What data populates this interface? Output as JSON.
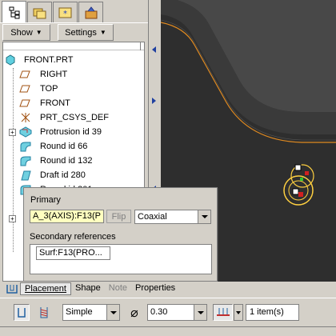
{
  "tabs": [
    {
      "icon": "model-tree-icon",
      "active": true
    },
    {
      "icon": "folder-browser-icon",
      "active": false
    },
    {
      "icon": "favorites-icon",
      "active": false
    },
    {
      "icon": "connections-icon",
      "active": false
    }
  ],
  "toolbar": {
    "show_label": "Show",
    "settings_label": "Settings"
  },
  "tree": {
    "root": "FRONT.PRT",
    "items": [
      {
        "label": "RIGHT",
        "icon": "datum-plane-icon"
      },
      {
        "label": "TOP",
        "icon": "datum-plane-icon"
      },
      {
        "label": "FRONT",
        "icon": "datum-plane-icon"
      },
      {
        "label": "PRT_CSYS_DEF",
        "icon": "csys-icon"
      },
      {
        "label": "Protrusion id 39",
        "icon": "protrusion-icon"
      },
      {
        "label": "Round id 66",
        "icon": "round-icon"
      },
      {
        "label": "Round id 132",
        "icon": "round-icon"
      },
      {
        "label": "Draft id 280",
        "icon": "draft-icon"
      },
      {
        "label": "Round id 301",
        "icon": "round-icon"
      }
    ]
  },
  "placement": {
    "primary_label": "Primary",
    "primary_value": "A_3(AXIS):F13(P",
    "flip_label": "Flip",
    "coaxial_value": "Coaxial",
    "secondary_label": "Secondary references",
    "secondary_item": "Surf:F13(PRO..."
  },
  "dashboard": {
    "tabs": [
      "Placement",
      "Shape",
      "Note",
      "Properties"
    ],
    "hole_profile": "Simple",
    "diameter": "0.30",
    "items": "1 item(s)"
  },
  "colors": {
    "graphics_bg": "#484848",
    "model_surface": "#2e2e2e",
    "edge_highlight": "#e08a20",
    "primary_field_bg": "#ffffc0"
  }
}
